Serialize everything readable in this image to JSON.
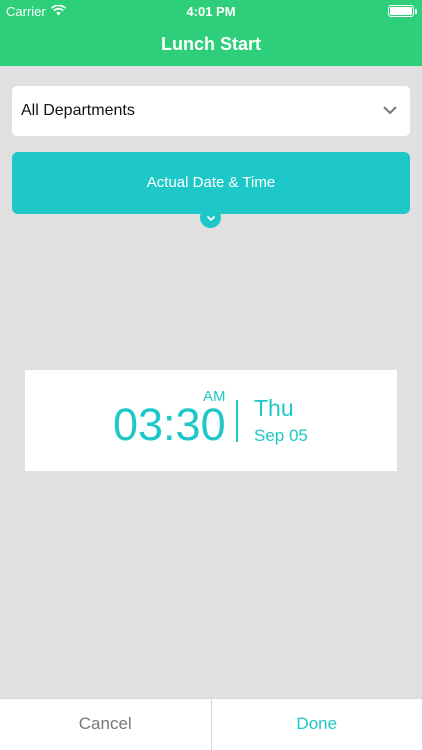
{
  "status_bar": {
    "carrier": "Carrier",
    "time": "4:01 PM",
    "wifi_icon": "wifi-icon",
    "battery_icon": "battery-icon"
  },
  "nav": {
    "title": "Lunch Start"
  },
  "department_select": {
    "value": "All Departments",
    "icon": "chevron-down-icon"
  },
  "actual_button": {
    "label": "Actual Date & Time"
  },
  "expand_toggle": {
    "icon": "chevron-down-icon"
  },
  "datetime": {
    "ampm": "AM",
    "time": "03:30",
    "day_of_week": "Thu",
    "date": "Sep 05"
  },
  "bottom_bar": {
    "cancel_label": "Cancel",
    "done_label": "Done"
  },
  "colors": {
    "header_green": "#2ecf7a",
    "accent_teal": "#1ec8c8",
    "background": "#e0e0e0"
  }
}
